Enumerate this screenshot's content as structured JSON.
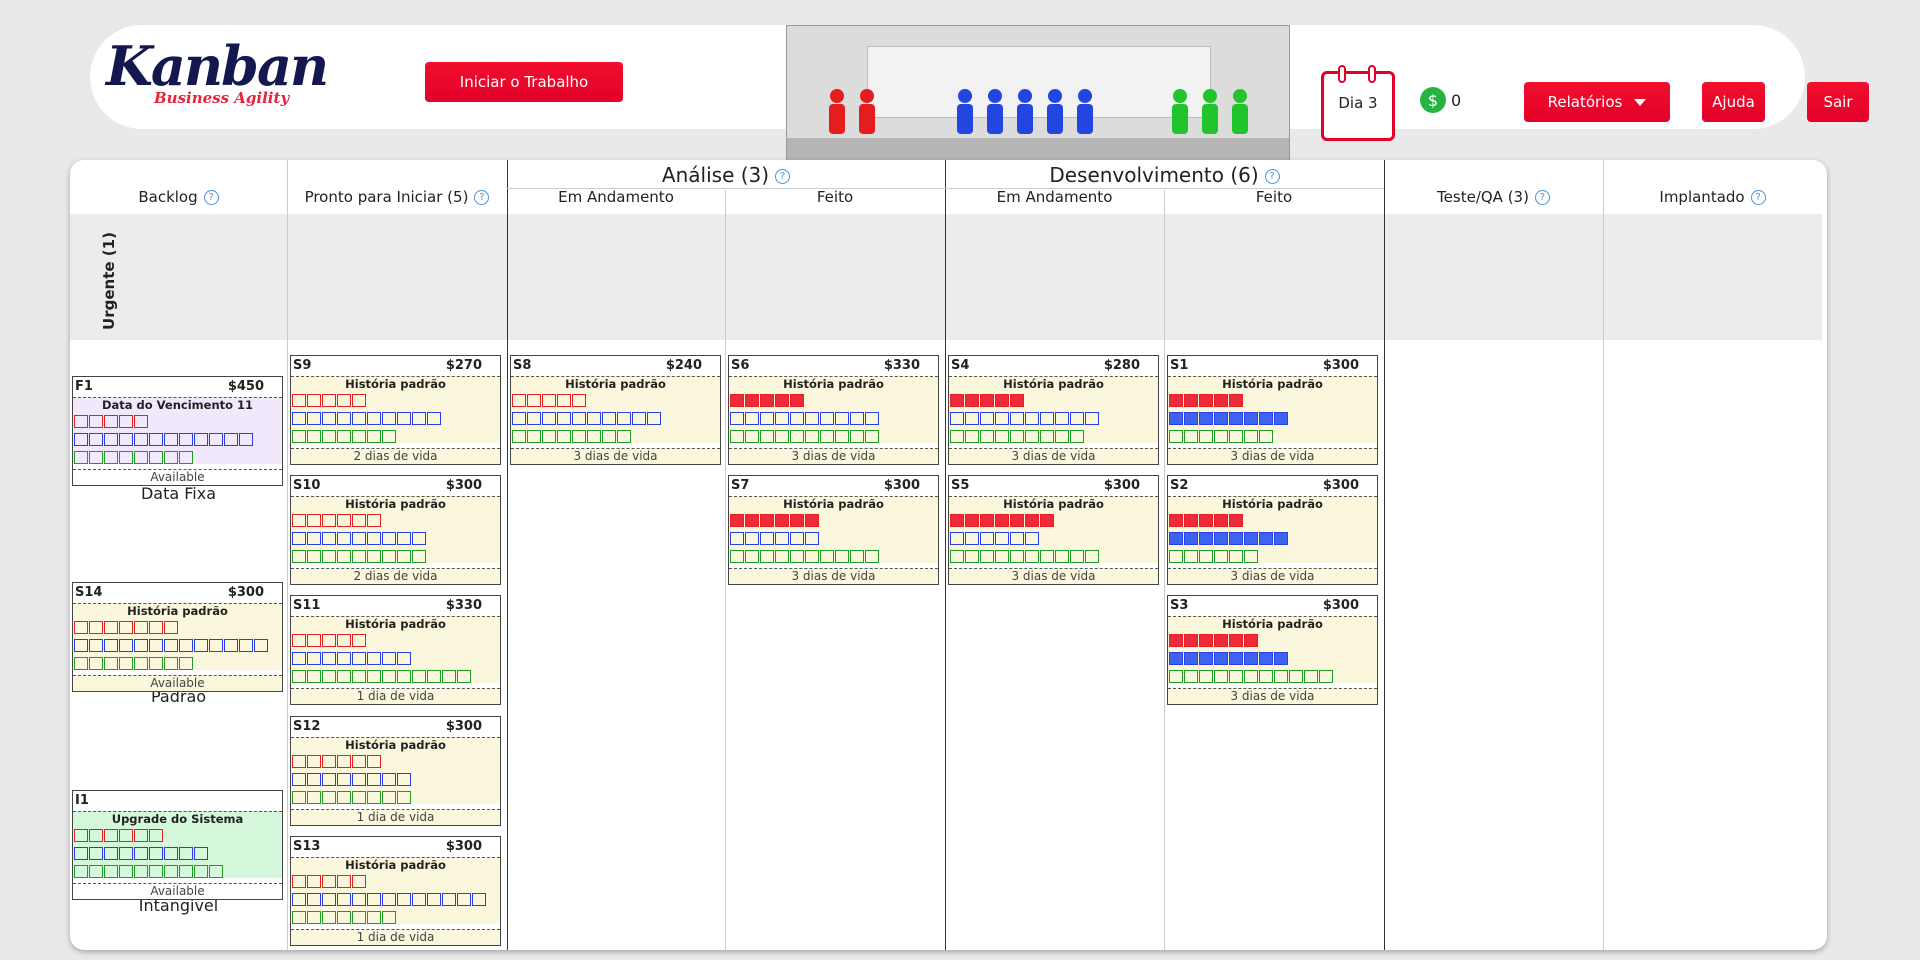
{
  "header": {
    "logo_title": "Kanban",
    "logo_subtitle": "Business Agility",
    "start_label": "Iniciar o Trabalho",
    "day_label": "Dia 3",
    "money_symbol": "$",
    "money_value": "0",
    "reports_label": "Relatórios",
    "help_label": "Ajuda",
    "exit_label": "Sair"
  },
  "board": {
    "columns": {
      "backlog": "Backlog",
      "ready": "Pronto para Iniciar (5)",
      "analysis": "Análise (3)",
      "analysis_doing": "Em Andamento",
      "analysis_done": "Feito",
      "dev": "Desenvolvimento (6)",
      "dev_doing": "Em Andamento",
      "dev_done": "Feito",
      "test": "Teste/QA (3)",
      "deployed": "Implantado"
    },
    "help_glyph": "?",
    "urgent_lane": "Urgente (1)",
    "class_labels": {
      "fixed": "Data Fixa",
      "standard": "Padrão",
      "intangible": "Intangível"
    }
  },
  "cards": [
    {
      "id": "F1",
      "value": "$450",
      "type": "Data do Vencimento 11",
      "footer": "Available",
      "red": [
        0,
        5
      ],
      "blue": [
        0,
        12
      ],
      "green": [
        0,
        8
      ]
    },
    {
      "id": "S14",
      "value": "$300",
      "type": "História padrão",
      "footer": "Available",
      "red": [
        0,
        7
      ],
      "blue": [
        0,
        13
      ],
      "green": [
        0,
        8
      ]
    },
    {
      "id": "I1",
      "value": "",
      "type": "Upgrade do Sistema",
      "footer": "Available",
      "red": [
        0,
        6
      ],
      "blue": [
        0,
        9
      ],
      "green": [
        0,
        10
      ]
    },
    {
      "id": "S9",
      "value": "$270",
      "type": "História padrão",
      "footer": "2 dias de vida",
      "red": [
        0,
        5
      ],
      "blue": [
        0,
        10
      ],
      "green": [
        0,
        7
      ]
    },
    {
      "id": "S10",
      "value": "$300",
      "type": "História padrão",
      "footer": "2 dias de vida",
      "red": [
        0,
        6
      ],
      "blue": [
        0,
        9
      ],
      "green": [
        0,
        9
      ]
    },
    {
      "id": "S11",
      "value": "$330",
      "type": "História padrão",
      "footer": "1 dia de vida",
      "red": [
        0,
        5
      ],
      "blue": [
        0,
        8
      ],
      "green": [
        0,
        12
      ]
    },
    {
      "id": "S12",
      "value": "$300",
      "type": "História padrão",
      "footer": "1 dia de vida",
      "red": [
        0,
        6
      ],
      "blue": [
        0,
        8
      ],
      "green": [
        0,
        8
      ]
    },
    {
      "id": "S13",
      "value": "$300",
      "type": "História padrão",
      "footer": "1 dia de vida",
      "red": [
        0,
        5
      ],
      "blue": [
        0,
        13
      ],
      "green": [
        0,
        7
      ]
    },
    {
      "id": "S8",
      "value": "$240",
      "type": "História padrão",
      "footer": "3 dias de vida",
      "red": [
        0,
        5
      ],
      "blue": [
        0,
        10
      ],
      "green": [
        0,
        8
      ]
    },
    {
      "id": "S6",
      "value": "$330",
      "type": "História padrão",
      "footer": "3 dias de vida",
      "red": [
        5,
        5
      ],
      "blue": [
        0,
        10
      ],
      "green": [
        0,
        10
      ]
    },
    {
      "id": "S7",
      "value": "$300",
      "type": "História padrão",
      "footer": "3 dias de vida",
      "red": [
        6,
        6
      ],
      "blue": [
        0,
        6
      ],
      "green": [
        0,
        10
      ]
    },
    {
      "id": "S4",
      "value": "$280",
      "type": "História padrão",
      "footer": "3 dias de vida",
      "red": [
        5,
        5
      ],
      "blue": [
        0,
        10
      ],
      "green": [
        0,
        9
      ]
    },
    {
      "id": "S5",
      "value": "$300",
      "type": "História padrão",
      "footer": "3 dias de vida",
      "red": [
        7,
        7
      ],
      "blue": [
        0,
        6
      ],
      "green": [
        0,
        10
      ]
    },
    {
      "id": "S1",
      "value": "$300",
      "type": "História padrão",
      "footer": "3 dias de vida",
      "red": [
        5,
        5
      ],
      "blue": [
        8,
        8
      ],
      "green": [
        0,
        7
      ]
    },
    {
      "id": "S2",
      "value": "$300",
      "type": "História padrão",
      "footer": "3 dias de vida",
      "red": [
        5,
        5
      ],
      "blue": [
        8,
        8
      ],
      "green": [
        0,
        6
      ]
    },
    {
      "id": "S3",
      "value": "$300",
      "type": "História padrão",
      "footer": "3 dias de vida",
      "red": [
        6,
        6
      ],
      "blue": [
        8,
        8
      ],
      "green": [
        0,
        11
      ]
    }
  ]
}
